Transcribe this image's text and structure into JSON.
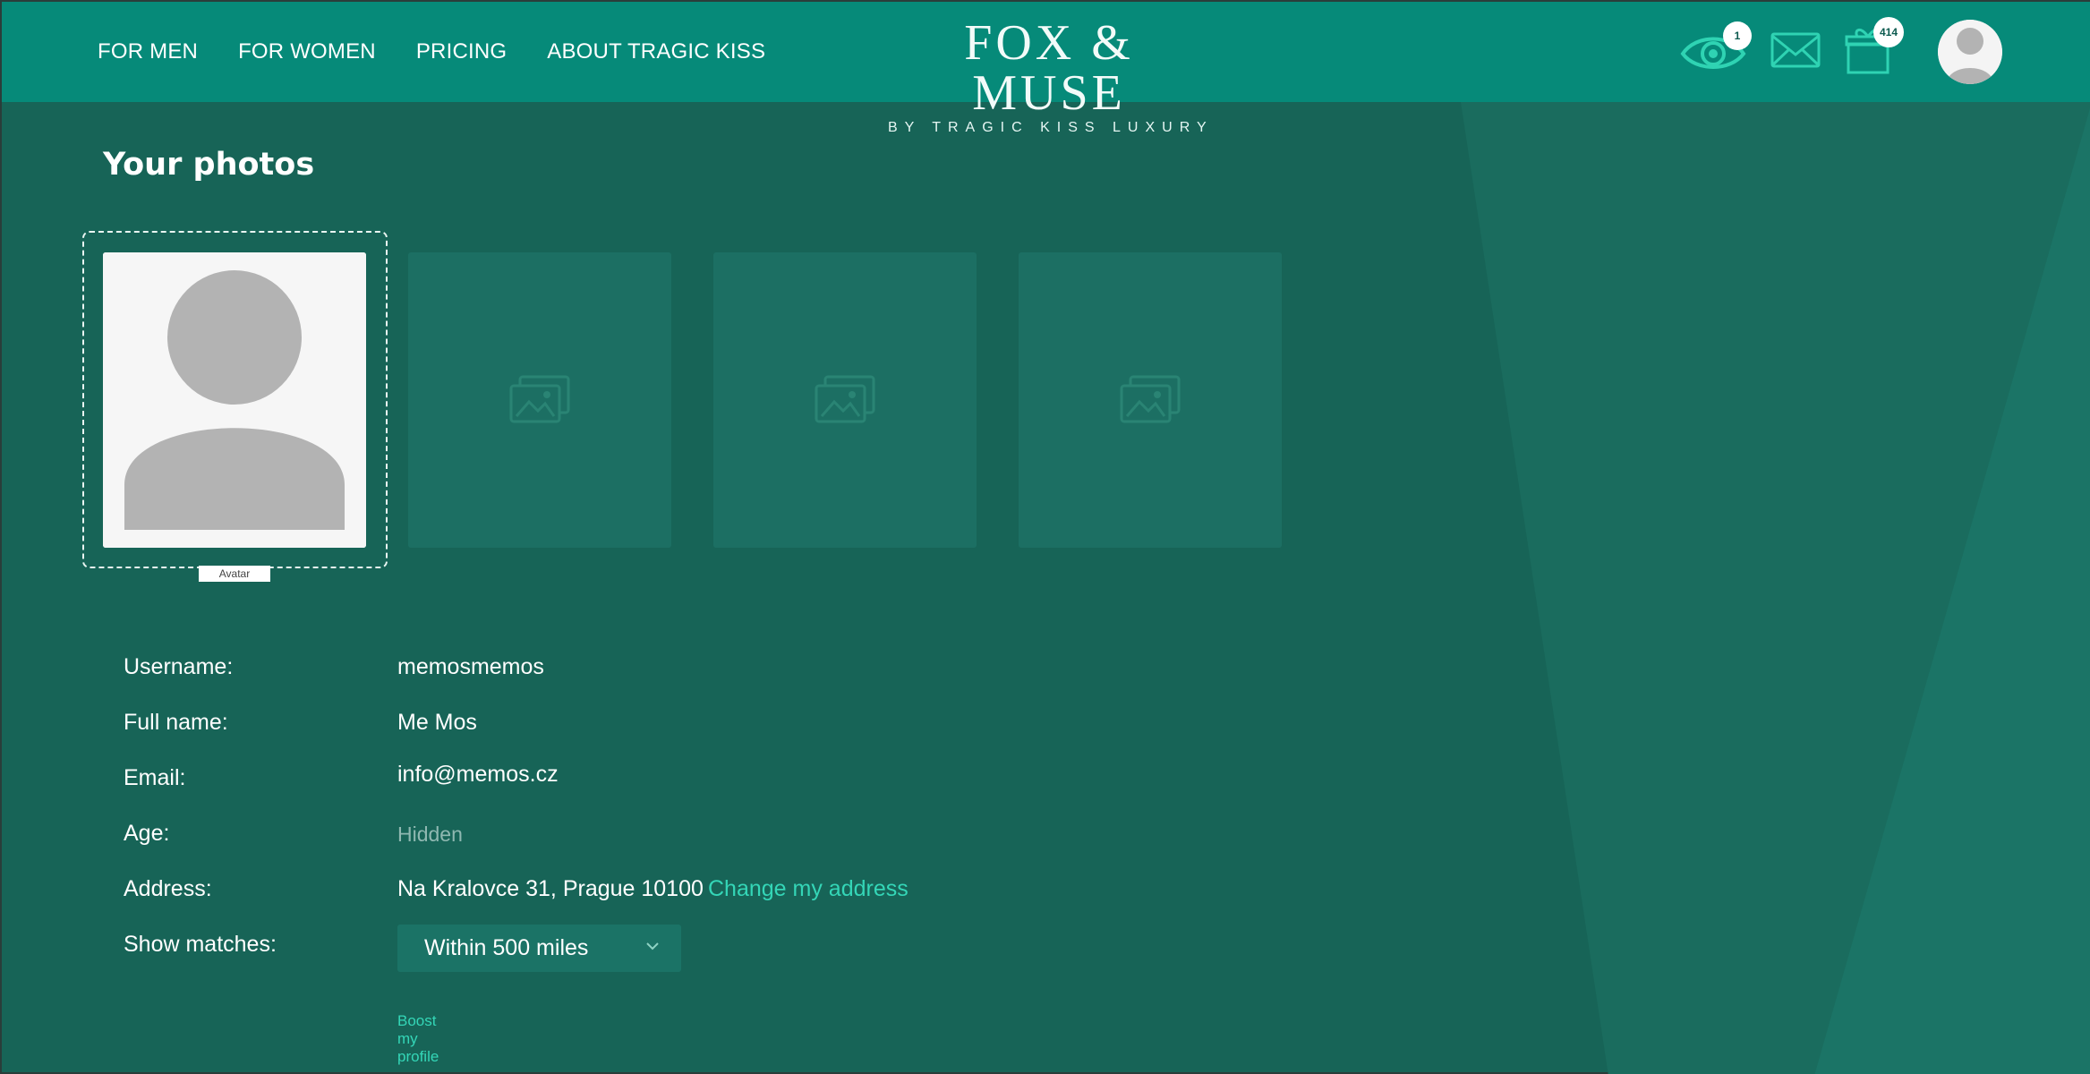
{
  "nav": {
    "items": [
      {
        "label": "FOR MEN"
      },
      {
        "label": "FOR WOMEN"
      },
      {
        "label": "PRICING"
      },
      {
        "label": "ABOUT TRAGIC KISS"
      }
    ]
  },
  "logo": {
    "line1": "FOX & MUSE",
    "line2": "BY TRAGIC KISS LUXURY"
  },
  "header_icons": {
    "views_icon": "eye-icon",
    "views_count": "1",
    "messages_icon": "envelope-icon",
    "gifts_icon": "gift-icon",
    "gifts_count": "414",
    "profile_icon": "avatar"
  },
  "main": {
    "title": "Your photos",
    "avatar_label": "Avatar",
    "slot_icon": "image-placeholder-icon"
  },
  "profile": {
    "username_label": "Username:",
    "username_value": "memosmemos",
    "fullname_label": "Full name:",
    "fullname_value": "Me Mos",
    "email_label": "Email:",
    "email_value": "info@memos.cz",
    "age_label": "Age:",
    "age_value": "Hidden",
    "address_label": "Address:",
    "address_value": "Na Kralovce 31, Prague 10100",
    "change_address_link": "Change my address",
    "matches_label": "Show matches:",
    "matches_value": "Within 500 miles",
    "boost_link": "Boost my profile"
  },
  "colors": {
    "header_bg": "#068a79",
    "page_bg": "#176457",
    "accent": "#34d6b7"
  }
}
